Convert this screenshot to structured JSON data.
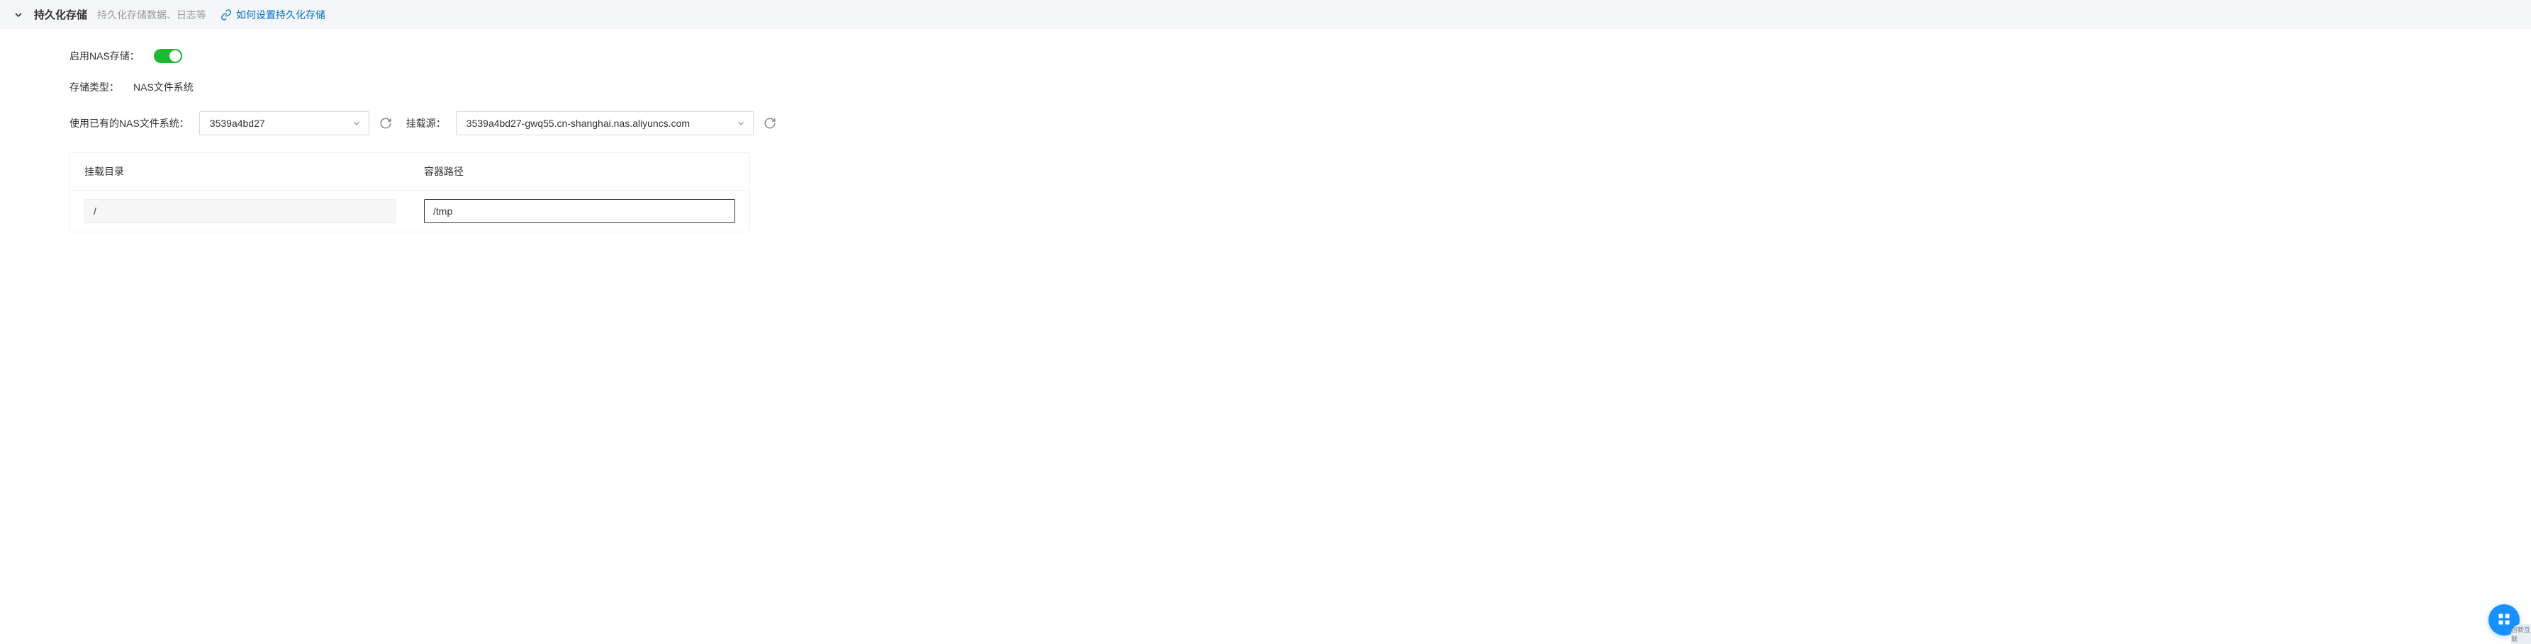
{
  "header": {
    "title": "持久化存储",
    "desc": "持久化存储数据、日志等",
    "help_label": "如何设置持久化存储"
  },
  "form": {
    "enable_nas_label": "启用NAS存储：",
    "storage_type_label": "存储类型：",
    "storage_type_value": "NAS文件系统",
    "existing_nas_label": "使用已有的NAS文件系统：",
    "nas_select_value": "3539a4bd27",
    "mount_source_label": "挂载源：",
    "mount_source_value": "3539a4bd27-gwq55.cn-shanghai.nas.aliyuncs.com"
  },
  "table": {
    "col_mount_dir": "挂载目录",
    "col_container_path": "容器路径",
    "row": {
      "mount_dir": "/",
      "container_path": "/tmp"
    }
  },
  "colors": {
    "accent_link": "#0070cc",
    "toggle_on": "#1bb934",
    "fab": "#1890ff"
  },
  "icons": {
    "chevron": "chevron-down-icon",
    "link": "link-icon",
    "refresh": "refresh-icon",
    "grid": "grid-icon"
  },
  "brand_text": "创新互联"
}
